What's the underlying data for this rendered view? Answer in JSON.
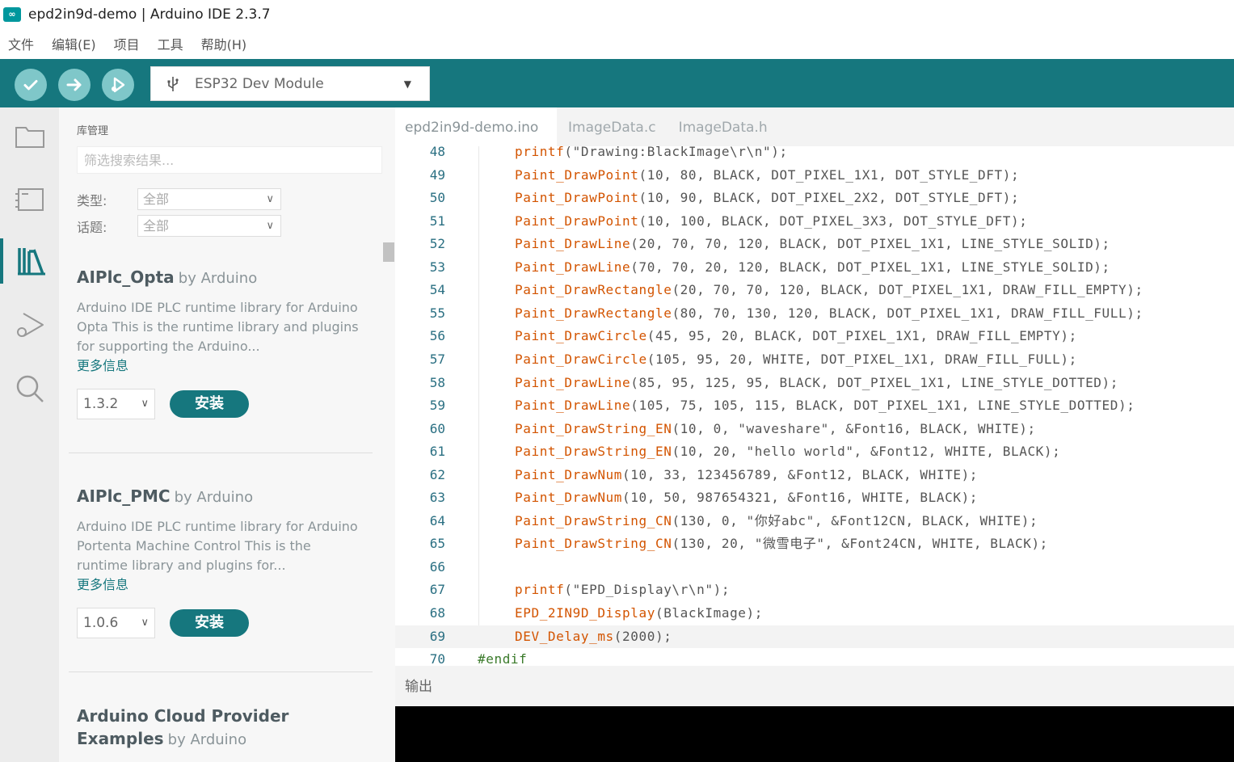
{
  "window": {
    "title": "epd2in9d-demo | Arduino IDE 2.3.7",
    "app_icon": "∞"
  },
  "menu": [
    "文件",
    "编辑(E)",
    "项目",
    "工具",
    "帮助(H)"
  ],
  "toolbar": {
    "board": "ESP32 Dev Module",
    "accent": "#16777e"
  },
  "library": {
    "title": "库管理",
    "search_placeholder": "筛选搜索结果...",
    "filters": [
      {
        "label": "类型:",
        "value": "全部"
      },
      {
        "label": "话题:",
        "value": "全部"
      }
    ],
    "cards": [
      {
        "name": "AIPlc_Opta",
        "by": "by Arduino",
        "desc": "Arduino IDE PLC runtime library for Arduino Opta This is the runtime library and plugins for supporting the Arduino...",
        "more": "更多信息",
        "version": "1.3.2",
        "install": "安装"
      },
      {
        "name": "AIPlc_PMC",
        "by": "by Arduino",
        "desc": "Arduino IDE PLC runtime library for Arduino Portenta Machine Control This is the runtime library and plugins for...",
        "more": "更多信息",
        "version": "1.0.6",
        "install": "安装"
      },
      {
        "name": "Arduino Cloud Provider",
        "name2": "Examples",
        "by": "by Arduino"
      }
    ]
  },
  "tabs": [
    "epd2in9d-demo.ino",
    "ImageData.c",
    "ImageData.h"
  ],
  "editor": {
    "lines": [
      {
        "n": "48",
        "fn": "printf",
        "rest": "(\"Drawing:BlackImage\\r\\n\");"
      },
      {
        "n": "49",
        "fn": "Paint_DrawPoint",
        "rest": "(10, 80, BLACK, DOT_PIXEL_1X1, DOT_STYLE_DFT);"
      },
      {
        "n": "50",
        "fn": "Paint_DrawPoint",
        "rest": "(10, 90, BLACK, DOT_PIXEL_2X2, DOT_STYLE_DFT);"
      },
      {
        "n": "51",
        "fn": "Paint_DrawPoint",
        "rest": "(10, 100, BLACK, DOT_PIXEL_3X3, DOT_STYLE_DFT);"
      },
      {
        "n": "52",
        "fn": "Paint_DrawLine",
        "rest": "(20, 70, 70, 120, BLACK, DOT_PIXEL_1X1, LINE_STYLE_SOLID);"
      },
      {
        "n": "53",
        "fn": "Paint_DrawLine",
        "rest": "(70, 70, 20, 120, BLACK, DOT_PIXEL_1X1, LINE_STYLE_SOLID);"
      },
      {
        "n": "54",
        "fn": "Paint_DrawRectangle",
        "rest": "(20, 70, 70, 120, BLACK, DOT_PIXEL_1X1, DRAW_FILL_EMPTY);"
      },
      {
        "n": "55",
        "fn": "Paint_DrawRectangle",
        "rest": "(80, 70, 130, 120, BLACK, DOT_PIXEL_1X1, DRAW_FILL_FULL);"
      },
      {
        "n": "56",
        "fn": "Paint_DrawCircle",
        "rest": "(45, 95, 20, BLACK, DOT_PIXEL_1X1, DRAW_FILL_EMPTY);"
      },
      {
        "n": "57",
        "fn": "Paint_DrawCircle",
        "rest": "(105, 95, 20, WHITE, DOT_PIXEL_1X1, DRAW_FILL_FULL);"
      },
      {
        "n": "58",
        "fn": "Paint_DrawLine",
        "rest": "(85, 95, 125, 95, BLACK, DOT_PIXEL_1X1, LINE_STYLE_DOTTED);"
      },
      {
        "n": "59",
        "fn": "Paint_DrawLine",
        "rest": "(105, 75, 105, 115, BLACK, DOT_PIXEL_1X1, LINE_STYLE_DOTTED);"
      },
      {
        "n": "60",
        "fn": "Paint_DrawString_EN",
        "rest": "(10, 0, \"waveshare\", &Font16, BLACK, WHITE);"
      },
      {
        "n": "61",
        "fn": "Paint_DrawString_EN",
        "rest": "(10, 20, \"hello world\", &Font12, WHITE, BLACK);"
      },
      {
        "n": "62",
        "fn": "Paint_DrawNum",
        "rest": "(10, 33, 123456789, &Font12, BLACK, WHITE);"
      },
      {
        "n": "63",
        "fn": "Paint_DrawNum",
        "rest": "(10, 50, 987654321, &Font16, WHITE, BLACK);"
      },
      {
        "n": "64",
        "fn": "Paint_DrawString_CN",
        "rest": "(130, 0, \"你好abc\", &Font12CN, BLACK, WHITE);"
      },
      {
        "n": "65",
        "fn": "Paint_DrawString_CN",
        "rest": "(130, 20, \"微雪电子\", &Font24CN, WHITE, BLACK);"
      },
      {
        "n": "66",
        "fn": "",
        "rest": ""
      },
      {
        "n": "67",
        "fn": "printf",
        "rest": "(\"EPD_Display\\r\\n\");"
      },
      {
        "n": "68",
        "fn": "EPD_2IN9D_Display",
        "rest": "(BlackImage);"
      },
      {
        "n": "69",
        "fn": "DEV_Delay_ms",
        "rest": "(2000);"
      },
      {
        "n": "70",
        "fn": "",
        "rest": "#endif"
      }
    ]
  },
  "output": {
    "title": "输出"
  }
}
